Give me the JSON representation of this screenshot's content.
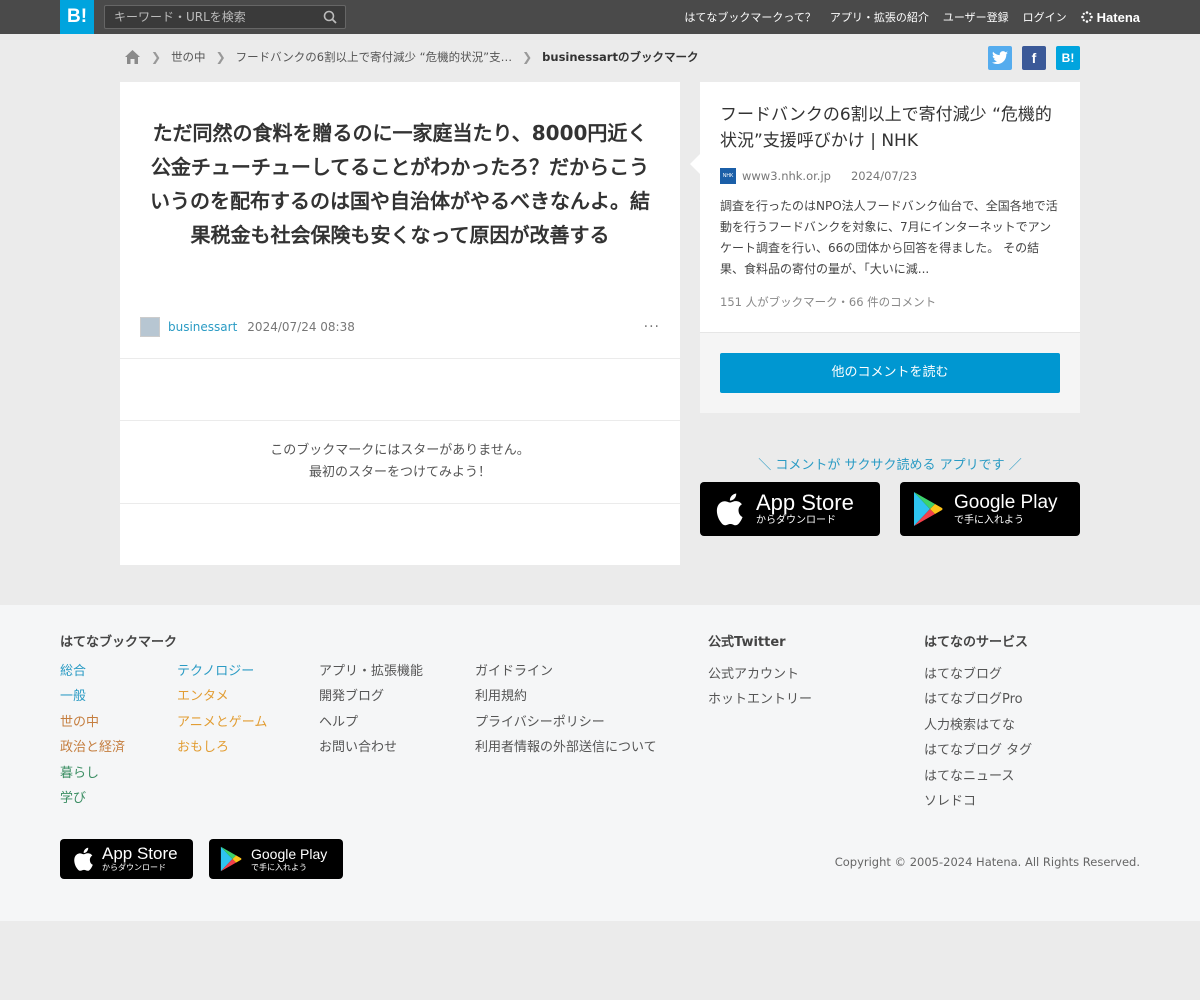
{
  "header": {
    "logo": "B!",
    "search_placeholder": "キーワード・URLを検索",
    "nav": [
      "はてなブックマークって？",
      "アプリ・拡張の紹介",
      "ユーザー登録",
      "ログイン"
    ],
    "brand": "Hatena"
  },
  "breadcrumb": {
    "items": [
      "世の中",
      "フードバンクの6割以上で寄付減少 “危機的状況”支…"
    ],
    "current": "businessartのブックマーク"
  },
  "share": {
    "twitter": "t",
    "facebook": "f",
    "hatena": "B!"
  },
  "bookmark": {
    "comment": "ただ同然の食料を贈るのに一家庭当たり、8000円近く公金チューチューしてることがわかったろ？だからこういうのを配布するのは国や自治体がやるべきなんよ。結果税金も社会保険も安くなって原因が改善する",
    "user": "businessart",
    "date": "2024/07/24 08:38",
    "more": "···",
    "stars_line1": "このブックマークにはスターがありません。",
    "stars_line2": "最初のスターをつけてみよう！"
  },
  "entry": {
    "title": "フードバンクの6割以上で寄付減少 “危機的状況”支援呼びかけ | NHK",
    "favicon": "NHK",
    "domain": "www3.nhk.or.jp",
    "date": "2024/07/23",
    "description": "調査を行ったのはNPO法人フードバンク仙台で、全国各地で活動を行うフードバンクを対象に、7月にインターネットでアンケート調査を行い、66の団体から回答を得ました。 その結果、食料品の寄付の量が、「大いに減...",
    "counts": "151 人がブックマーク・66 件のコメント",
    "read_button": "他のコメントを読む"
  },
  "promo": {
    "text": "＼ コメントが サクサク読める アプリです ／",
    "appstore_big": "App Store",
    "appstore_small": "からダウンロード",
    "googleplay_big": "Google Play",
    "googleplay_small": "で手に入れよう"
  },
  "footer": {
    "bookmark_head": "はてなブックマーク",
    "categories_col1": [
      "総合",
      "一般",
      "世の中",
      "政治と経済",
      "暮らし",
      "学び"
    ],
    "categories_col1_colors": [
      "#2a9bc4",
      "#2a9bc4",
      "#c57e3f",
      "#c57e3f",
      "#3b8e63",
      "#3b8e63"
    ],
    "categories_col2": [
      "テクノロジー",
      "エンタメ",
      "アニメとゲーム",
      "おもしろ"
    ],
    "categories_col2_colors": [
      "#2a9bc4",
      "#e29d33",
      "#e29d33",
      "#e29d33"
    ],
    "links_col3": [
      "アプリ・拡張機能",
      "開発ブログ",
      "ヘルプ",
      "お問い合わせ"
    ],
    "links_col4": [
      "ガイドライン",
      "利用規約",
      "プライバシーポリシー",
      "利用者情報の外部送信について"
    ],
    "twitter_head": "公式Twitter",
    "twitter_links": [
      "公式アカウント",
      "ホットエントリー"
    ],
    "services_head": "はてなのサービス",
    "services_links": [
      "はてなブログ",
      "はてなブログPro",
      "人力検索はてな",
      "はてなブログ タグ",
      "はてなニュース",
      "ソレドコ"
    ],
    "copyright": "Copyright © 2005-2024 Hatena. All Rights Reserved."
  },
  "colors": {
    "header_bg": "#4a4a4a",
    "brand_blue": "#00a4de",
    "button_blue": "#0097d1",
    "twitter": "#55acee",
    "facebook": "#3b5998"
  }
}
